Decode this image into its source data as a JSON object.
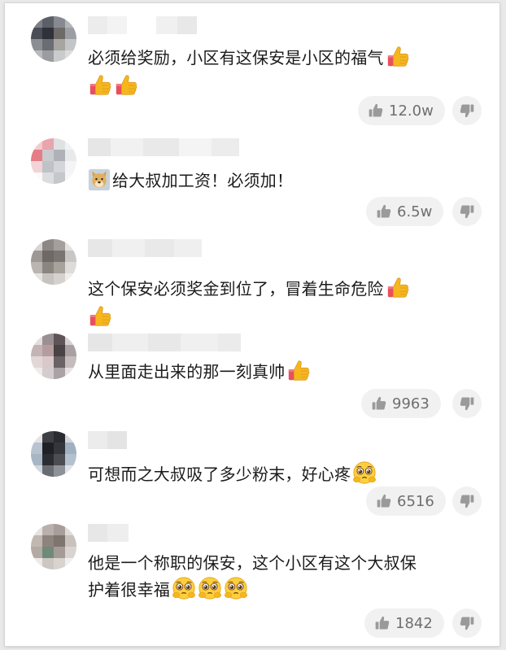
{
  "comments": [
    {
      "text": "必须给奖励，小区有这保安是小区的福气",
      "likes": "12.0w",
      "emojis_inline": [
        "thumbs-up"
      ],
      "emojis_next_line": [
        "thumbs-up",
        "thumbs-up"
      ]
    },
    {
      "text": "给大叔加工资！必须加！",
      "likes": "6.5w",
      "emojis_leading": [
        "doge"
      ]
    },
    {
      "text": "这个保安必须奖金到位了，冒着生命危险",
      "likes": "",
      "emojis_inline": [
        "thumbs-up"
      ],
      "emojis_next_line": [
        "thumbs-up"
      ]
    },
    {
      "text": "从里面走出来的那一刻真帅",
      "likes": "9963",
      "emojis_inline": [
        "thumbs-up"
      ]
    },
    {
      "text": "可想而之大叔吸了多少粉末，好心疼",
      "likes": "6516",
      "emojis_inline": [
        "pleading-face"
      ]
    },
    {
      "text_line1": "他是一个称职的保安，这个小区有这个大叔保",
      "text_line2": "护着很幸福",
      "likes": "1842",
      "emojis_inline": [
        "pleading-face",
        "pleading-face",
        "pleading-face"
      ]
    }
  ],
  "colors": {
    "text": "#1b1b1b",
    "like_bg": "#f1f1f1",
    "like_text": "#6f6f6f",
    "thumb_yellow": "#f6b61e",
    "cuff_red": "#e8505b"
  }
}
